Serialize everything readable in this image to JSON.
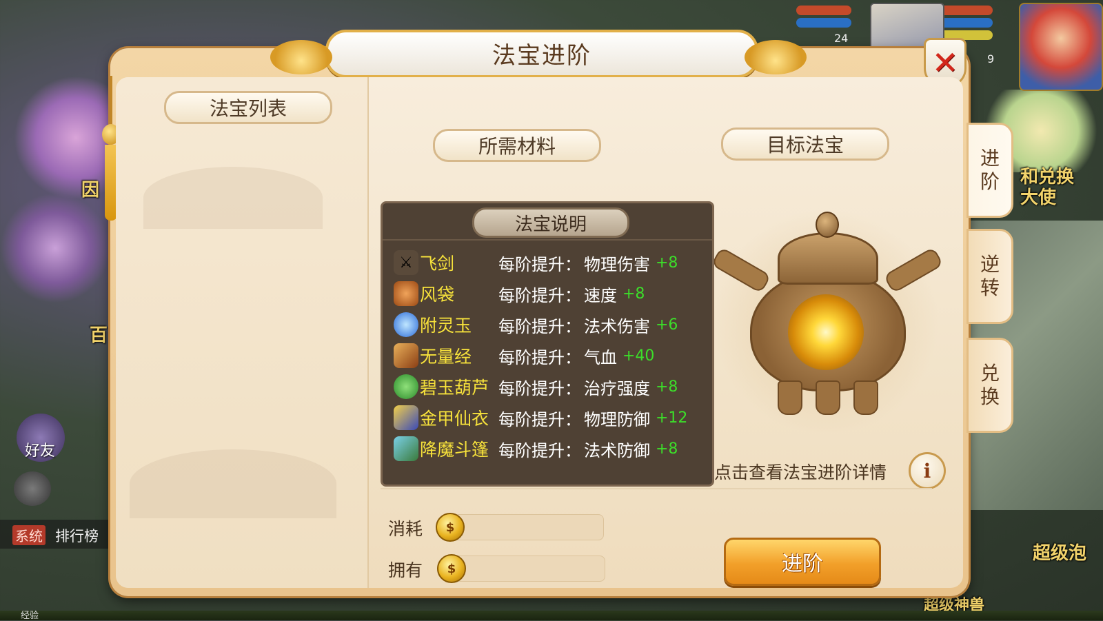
{
  "window": {
    "title": "法宝进阶",
    "close_icon": "close-icon"
  },
  "left_panel": {
    "title": "法宝列表"
  },
  "sections": {
    "materials_title": "所需材料",
    "target_title": "目标法宝"
  },
  "description": {
    "title": "法宝说明",
    "prefix": "每阶提升：",
    "items": [
      {
        "name": "飞剑",
        "icon": "sword-icon",
        "attr": "物理伤害",
        "value": "+8"
      },
      {
        "name": "风袋",
        "icon": "wind-bag-icon",
        "attr": "速度",
        "value": "+8"
      },
      {
        "name": "附灵玉",
        "icon": "jade-icon",
        "attr": "法术伤害",
        "value": "+6"
      },
      {
        "name": "无量经",
        "icon": "scroll-icon",
        "attr": "气血",
        "value": "+40"
      },
      {
        "name": "碧玉葫芦",
        "icon": "gourd-icon",
        "attr": "治疗强度",
        "value": "+8"
      },
      {
        "name": "金甲仙衣",
        "icon": "armor-icon",
        "attr": "物理防御",
        "value": "+12"
      },
      {
        "name": "降魔斗篷",
        "icon": "cloak-icon",
        "attr": "法术防御",
        "value": "+8"
      }
    ]
  },
  "target": {
    "image": "teapot-treasure-icon",
    "detail_link": "点击查看法宝进阶详情",
    "info_label": "i"
  },
  "cost": {
    "consume_label": "消耗",
    "own_label": "拥有",
    "coin_icon": "coin-icon"
  },
  "actions": {
    "advance_label": "进阶"
  },
  "tabs": [
    {
      "label": "进\n阶",
      "active": true
    },
    {
      "label": "逆\n转",
      "active": false
    },
    {
      "label": "兑\n换",
      "active": false
    }
  ],
  "background": {
    "friends_label": "好友",
    "system_tag": "系统",
    "ranking_label": "排行榜",
    "exp_label": "经验",
    "side_text_left_1": "因",
    "side_text_left_2": "百",
    "side_text_right_1": "和兑换",
    "side_text_right_2": "大使",
    "side_text_right_3": "超级泡",
    "bottom_text": "超级神兽",
    "level_1": "24",
    "level_2": "9"
  }
}
